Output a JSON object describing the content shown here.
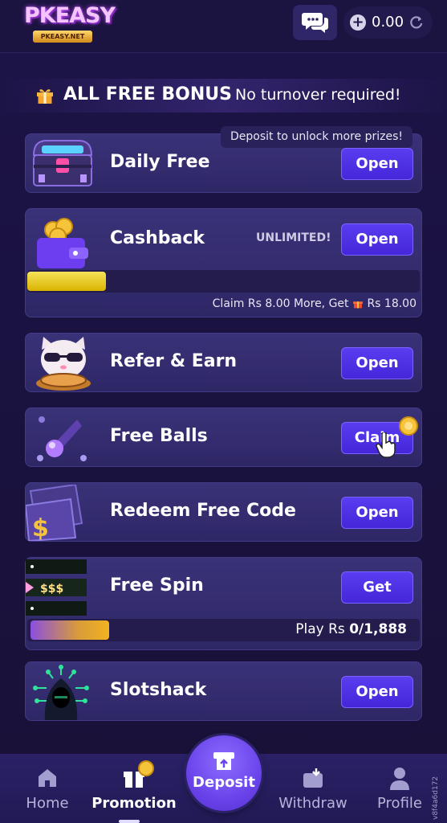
{
  "header": {
    "logo_text": "PKEASY",
    "logo_sub": "PKEASY.NET",
    "balance": "0.00"
  },
  "banner": {
    "title": "ALL FREE BONUS",
    "subtitle": "No turnover required!"
  },
  "cards": {
    "daily_free": {
      "title": "Daily Free",
      "button": "Open",
      "tooltip": "Deposit to unlock more prizes!"
    },
    "cashback": {
      "title": "Cashback",
      "badge": "UNLIMITED!",
      "button": "Open",
      "note_prefix": "Claim Rs 8.00 More, Get",
      "note_amount": "Rs 18.00",
      "progress": 0.2
    },
    "refer": {
      "title": "Refer & Earn",
      "button": "Open"
    },
    "free_balls": {
      "title": "Free Balls",
      "button": "Claim"
    },
    "redeem": {
      "title": "Redeem Free Code",
      "button": "Open"
    },
    "free_spin": {
      "title": "Free Spin",
      "button": "Get",
      "play_label": "Play Rs",
      "play_value": "0/1,888",
      "ticket_text": "$$$",
      "progress": 0.2
    },
    "slotshack": {
      "title": "Slotshack",
      "button": "Open"
    }
  },
  "nav": {
    "home": "Home",
    "promotion": "Promotion",
    "deposit": "Deposit",
    "withdraw": "Withdraw",
    "profile": "Profile"
  },
  "version": "v8f4a6d172",
  "colors": {
    "background": "#1a1240",
    "card": "#352d70",
    "button": "#4f32e6",
    "cashback_bar": "#e8c924"
  }
}
